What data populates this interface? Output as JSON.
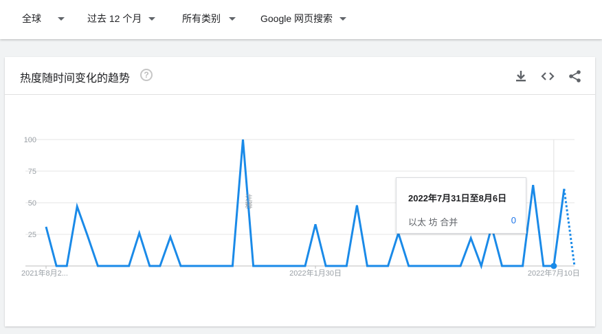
{
  "filters": [
    {
      "label": "全球"
    },
    {
      "label": "过去 12 个月"
    },
    {
      "label": "所有类别"
    },
    {
      "label": "Google 网页搜索"
    }
  ],
  "card": {
    "title": "热度随时间变化的趋势",
    "help_icon": "?"
  },
  "tooltip": {
    "date": "2022年7月31日至8月6日",
    "term": "以太 坊 合并",
    "value": "0"
  },
  "colors": {
    "series": "#1a8ae8",
    "grid": "#e6e6e6",
    "axis_text": "#9aa0a6"
  },
  "note_text": "注释",
  "chart_data": {
    "type": "line",
    "title": "",
    "xlabel": "",
    "ylabel": "",
    "ylim": [
      0,
      100
    ],
    "yticks": [
      25,
      50,
      75,
      100
    ],
    "xtick_labels": [
      "2021年8月2...",
      "2022年1月30日",
      "2022年7月10日"
    ],
    "xtick_index": [
      0,
      26,
      49
    ],
    "series": [
      {
        "name": "以太 坊 合并",
        "values": [
          31,
          0,
          0,
          47,
          24,
          0,
          0,
          0,
          0,
          26,
          0,
          0,
          23,
          0,
          0,
          0,
          0,
          0,
          0,
          100,
          0,
          0,
          0,
          0,
          0,
          0,
          33,
          0,
          0,
          0,
          48,
          0,
          0,
          0,
          26,
          0,
          0,
          0,
          0,
          0,
          0,
          22,
          0,
          31,
          0,
          0,
          0,
          64,
          0,
          0,
          61,
          0
        ],
        "partial_from": 50
      }
    ],
    "highlight_index": 49,
    "grid": true
  }
}
